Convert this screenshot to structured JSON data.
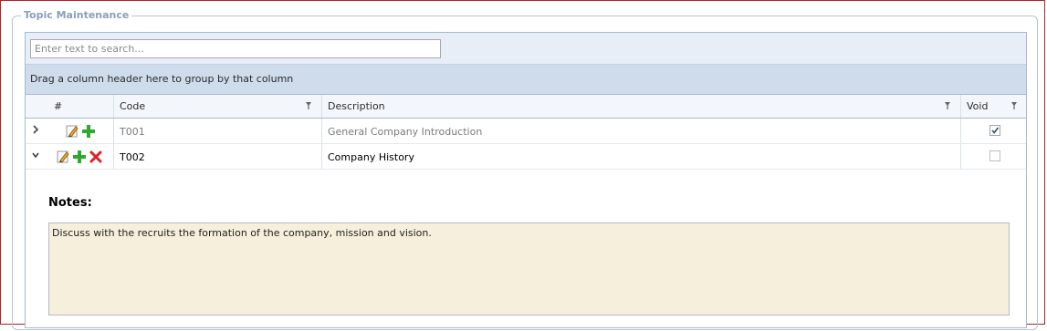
{
  "panel": {
    "title": "Topic Maintenance"
  },
  "search": {
    "placeholder": "Enter text to search..."
  },
  "group_panel": {
    "text": "Drag a column header here to group by that column"
  },
  "columns": {
    "index": "#",
    "code": "Code",
    "description": "Description",
    "void": "Void"
  },
  "rows": [
    {
      "code": "T001",
      "description": "General Company Introduction",
      "void": true,
      "expanded": false,
      "actions": [
        "edit-icon",
        "add-icon"
      ]
    },
    {
      "code": "T002",
      "description": "Company History",
      "void": false,
      "expanded": true,
      "actions": [
        "edit-icon",
        "add-icon",
        "delete-icon"
      ]
    }
  ],
  "detail": {
    "notes_label": "Notes:",
    "notes_text": "Discuss with the recruits the formation of the company, mission and vision."
  },
  "colors": {
    "frame_border": "#b22222",
    "header_bg": "#cfdceb",
    "notes_bg": "#f6efdc",
    "add_green": "#2fa82f",
    "delete_red": "#e02020"
  }
}
